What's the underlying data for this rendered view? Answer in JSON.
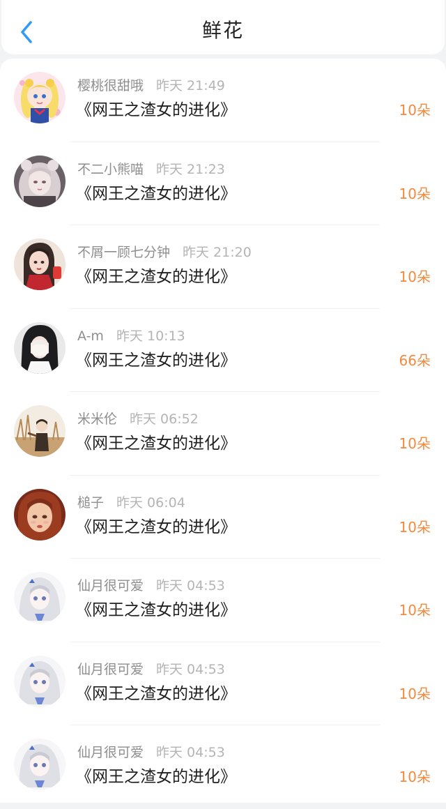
{
  "header": {
    "title": "鲜花",
    "back_icon": "chevron-left-icon",
    "accent_color": "#2f9bf5"
  },
  "records": [
    {
      "user": "樱桃很甜哦",
      "time": "昨天 21:49",
      "book": "《网王之渣女的进化》",
      "amount": "10朵",
      "avatar": "sailor-moon-avatar"
    },
    {
      "user": "不二小熊喵",
      "time": "昨天 21:23",
      "book": "《网王之渣女的进化》",
      "amount": "10朵",
      "avatar": "pale-girl-avatar"
    },
    {
      "user": "不屑一顾七分钟",
      "time": "昨天 21:20",
      "book": "《网王之渣女的进化》",
      "amount": "10朵",
      "avatar": "girl-red-dress-avatar"
    },
    {
      "user": "A-m",
      "time": "昨天 10:13",
      "book": "《网王之渣女的进化》",
      "amount": "66朵",
      "avatar": "girl-covering-face-avatar"
    },
    {
      "user": "米米伦",
      "time": "昨天 06:52",
      "book": "《网王之渣女的进化》",
      "amount": "10朵",
      "avatar": "field-boy-avatar"
    },
    {
      "user": "槌子",
      "time": "昨天 06:04",
      "book": "《网王之渣女的进化》",
      "amount": "10朵",
      "avatar": "painted-girl-avatar"
    },
    {
      "user": "仙月很可爱",
      "time": "昨天 04:53",
      "book": "《网王之渣女的进化》",
      "amount": "10朵",
      "avatar": "anime-girl-avatar"
    },
    {
      "user": "仙月很可爱",
      "time": "昨天 04:53",
      "book": "《网王之渣女的进化》",
      "amount": "10朵",
      "avatar": "anime-girl-avatar"
    },
    {
      "user": "仙月很可爱",
      "time": "昨天 04:53",
      "book": "《网王之渣女的进化》",
      "amount": "10朵",
      "avatar": "anime-girl-avatar"
    }
  ],
  "colors": {
    "amount": "#f28a3e",
    "username": "#8e8e8e",
    "timestamp": "#b4b4b4",
    "book_title": "#1f1f1f"
  }
}
